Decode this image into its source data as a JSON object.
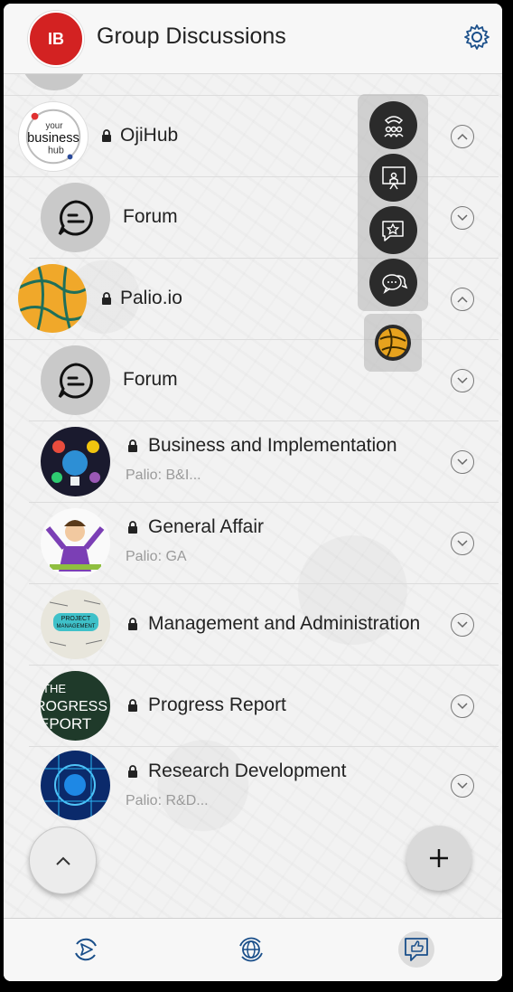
{
  "header": {
    "logo_text": "IB",
    "title": "Group Discussions",
    "settings_icon": "gear-icon"
  },
  "list": [
    {
      "id": "ojihub",
      "name": "OjiHub",
      "locked": true,
      "avatar_text": "your business hub",
      "indent": false
    },
    {
      "id": "forum-1",
      "name": "Forum",
      "locked": false,
      "avatar_icon": "forum-icon",
      "indent": true
    },
    {
      "id": "palio",
      "name": "Palio.io",
      "locked": true,
      "avatar_icon": "palio-logo",
      "indent": false
    },
    {
      "id": "forum-2",
      "name": "Forum",
      "locked": false,
      "avatar_icon": "forum-icon",
      "indent": true
    },
    {
      "id": "business",
      "name": "Business and Implementation",
      "locked": true,
      "subtitle": "Palio: B&I...",
      "indent": true
    },
    {
      "id": "general",
      "name": "General Affair",
      "locked": true,
      "subtitle": "Palio: GA",
      "indent": true
    },
    {
      "id": "management",
      "name": "Management and Administration",
      "locked": true,
      "avatar_text": "PROJECT MANAGEMENT",
      "indent": true
    },
    {
      "id": "progress",
      "name": "Progress Report",
      "locked": true,
      "avatar_text": "THE PROGRESS REPORT",
      "indent": true
    },
    {
      "id": "research",
      "name": "Research Development",
      "locked": true,
      "subtitle": "Palio: R&D...",
      "indent": true
    }
  ],
  "fab_menu": [
    "conference-call-icon",
    "presenter-icon",
    "star-chat-icon",
    "chat-bubbles-icon"
  ],
  "bottom_nav": [
    "send-refresh-icon",
    "globe-refresh-icon",
    "thumbs-up-chat-icon"
  ],
  "colors": {
    "accent": "#d32222",
    "palio": "#f0a82a",
    "dark": "#2b2b2b"
  }
}
